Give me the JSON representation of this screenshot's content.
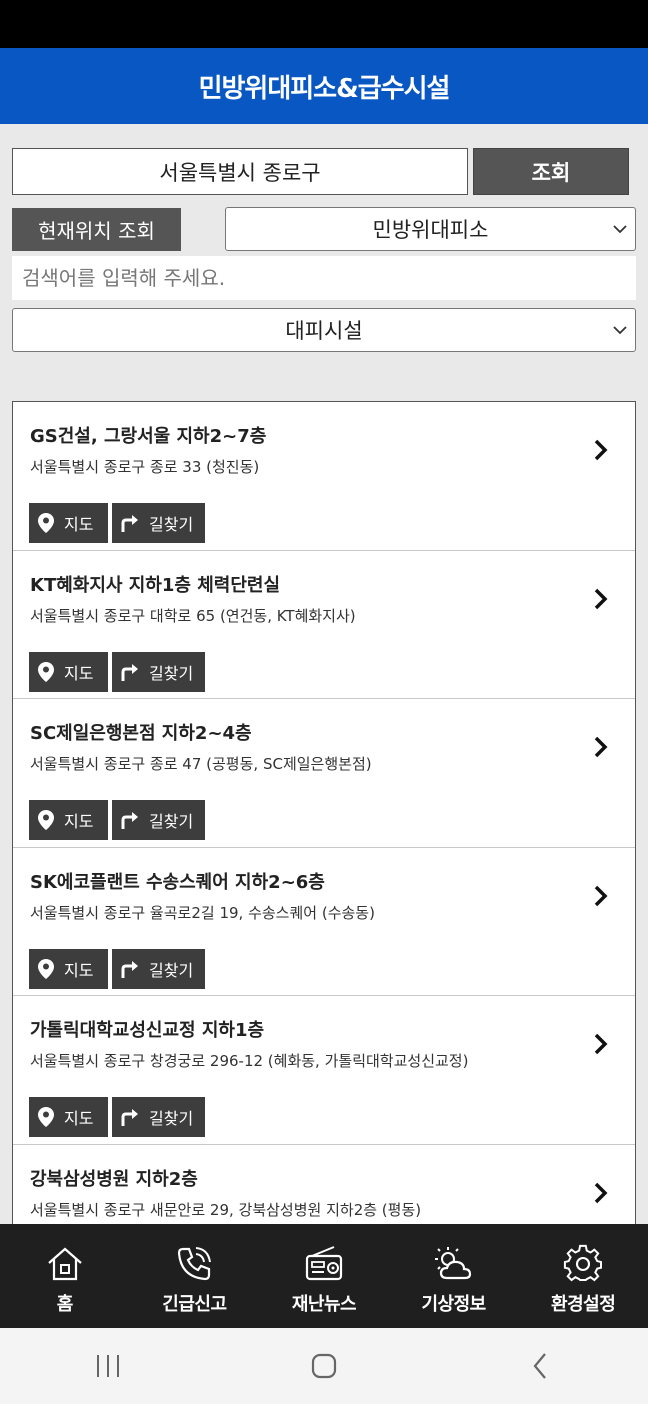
{
  "header": {
    "title": "민방위대피소&급수시설"
  },
  "search": {
    "region": "서울특별시 종로구",
    "search_label": "조회",
    "location_label": "현재위치 조회",
    "type_selected": "민방위대피소",
    "keyword_placeholder": "검색어를 입력해 주세요.",
    "facility_selected": "대피시설"
  },
  "list": {
    "map_label": "지도",
    "route_label": "길찾기",
    "items": [
      {
        "title": "GS건설, 그랑서울 지하2~7층",
        "address": "서울특별시 종로구 종로 33 (청진동)"
      },
      {
        "title": "KT혜화지사 지하1층 체력단련실",
        "address": "서울특별시 종로구 대학로 65 (연건동, KT혜화지사)"
      },
      {
        "title": "SC제일은행본점 지하2~4층",
        "address": "서울특별시 종로구 종로 47 (공평동, SC제일은행본점)"
      },
      {
        "title": "SK에코플랜트 수송스퀘어 지하2~6층",
        "address": "서울특별시 종로구 율곡로2길 19, 수송스퀘어 (수송동)"
      },
      {
        "title": "가톨릭대학교성신교정 지하1층",
        "address": "서울특별시 종로구 창경궁로 296-12 (혜화동, 가톨릭대학교성신교정)"
      },
      {
        "title": "강북삼성병원 지하2층",
        "address": "서울특별시 종로구 새문안로 29, 강북삼성병원 지하2층 (평동)"
      }
    ]
  },
  "nav": {
    "home": "홈",
    "emergency": "긴급신고",
    "news": "재난뉴스",
    "weather": "기상정보",
    "settings": "환경설정"
  },
  "colors": {
    "header": "#0857c3",
    "button_dark": "#555555",
    "navbar": "#1f1f1f"
  }
}
